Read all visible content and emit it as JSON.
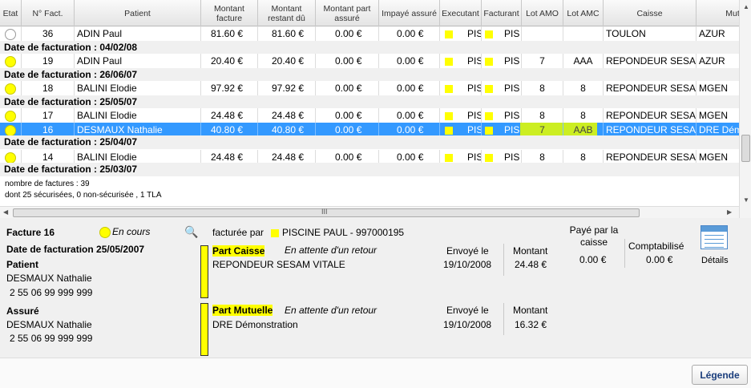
{
  "columns": [
    "Etat",
    "N° Fact.",
    "Patient",
    "Montant facture",
    "Montant restant dû",
    "Montant part assuré",
    "Impayé assuré",
    "Executant",
    "Facturant",
    "Lot AMO",
    "Lot AMC",
    "Caisse",
    "Mut"
  ],
  "rows": [
    {
      "kind": "data",
      "state": "empty",
      "num": "36",
      "patient": "ADIN Paul",
      "montant": "81.60 €",
      "restant": "81.60 €",
      "part": "0.00 €",
      "impaye": "0.00 €",
      "exec": "PIS",
      "fact": "PIS",
      "amo": "",
      "amc": "",
      "caisse": "TOULON",
      "mut": "AZUR"
    },
    {
      "kind": "group",
      "label": "Date de facturation : 04/02/08"
    },
    {
      "kind": "data",
      "state": "yel",
      "num": "19",
      "patient": "ADIN Paul",
      "montant": "20.40 €",
      "restant": "20.40 €",
      "part": "0.00 €",
      "impaye": "0.00 €",
      "exec": "PIS",
      "fact": "PIS",
      "amo": "7",
      "amc": "AAA",
      "caisse": "REPONDEUR SESA",
      "mut": "AZUR"
    },
    {
      "kind": "group",
      "label": "Date de facturation : 26/06/07"
    },
    {
      "kind": "data",
      "state": "yel",
      "num": "18",
      "patient": "BALINI Elodie",
      "montant": "97.92 €",
      "restant": "97.92 €",
      "part": "0.00 €",
      "impaye": "0.00 €",
      "exec": "PIS",
      "fact": "PIS",
      "amo": "8",
      "amc": "8",
      "caisse": "REPONDEUR SESA",
      "mut": "MGEN"
    },
    {
      "kind": "group",
      "label": "Date de facturation : 25/05/07"
    },
    {
      "kind": "data",
      "state": "yel",
      "num": "17",
      "patient": "BALINI Elodie",
      "montant": "24.48 €",
      "restant": "24.48 €",
      "part": "0.00 €",
      "impaye": "0.00 €",
      "exec": "PIS",
      "fact": "PIS",
      "amo": "8",
      "amc": "8",
      "caisse": "REPONDEUR SESA",
      "mut": "MGEN"
    },
    {
      "kind": "sel",
      "state": "yel",
      "num": "16",
      "patient": "DESMAUX Nathalie",
      "montant": "40.80 €",
      "restant": "40.80 €",
      "part": "0.00 €",
      "impaye": "0.00 €",
      "exec": "PIS",
      "fact": "PIS",
      "amo": "7",
      "amc": "AAB",
      "caisse": "REPONDEUR SESA",
      "mut": "DRE Dém"
    },
    {
      "kind": "group",
      "label": "Date de facturation : 25/04/07"
    },
    {
      "kind": "data",
      "state": "yel",
      "num": "14",
      "patient": "BALINI Elodie",
      "montant": "24.48 €",
      "restant": "24.48 €",
      "part": "0.00 €",
      "impaye": "0.00 €",
      "exec": "PIS",
      "fact": "PIS",
      "amo": "8",
      "amc": "8",
      "caisse": "REPONDEUR SESA",
      "mut": "MGEN"
    },
    {
      "kind": "group",
      "label": "Date de facturation : 25/03/07"
    }
  ],
  "summary": {
    "count": "nombre de factures : 39",
    "detail": "dont 25 sécurisées, 0 non-sécurisée , 1 TLA"
  },
  "scroll": {
    "h_label": "III"
  },
  "invoice": {
    "title": "Facture 16",
    "status": "En cours",
    "billed_by_label": "facturée par",
    "billed_by": "PISCINE PAUL - 997000195",
    "date": "Date de facturation 25/05/2007",
    "patient_label": "Patient",
    "patient_name": "DESMAUX Nathalie",
    "patient_nir": "2 55 06 99 999 999",
    "assure_label": "Assuré",
    "assure_name": "DESMAUX Nathalie",
    "assure_nir": "2 55 06 99 999 999",
    "paid_label": "Payé par la caisse",
    "paid_value": "0.00 €",
    "compta_label": "Comptabilisé",
    "compta_value": "0.00 €",
    "details_label": "Détails"
  },
  "part_caisse": {
    "title": "Part Caisse",
    "status": "En attente d'un retour",
    "org": "REPONDEUR SESAM VITALE",
    "sent_label": "Envoyé le",
    "sent_date": "19/10/2008",
    "amount_label": "Montant",
    "amount": "24.48 €"
  },
  "part_mutuelle": {
    "title": "Part Mutuelle",
    "status": "En attente d'un retour",
    "org": "DRE Démonstration",
    "sent_label": "Envoyé le",
    "sent_date": "19/10/2008",
    "amount_label": "Montant",
    "amount": "16.32 €"
  },
  "legend_button": "Légende",
  "colors": {
    "selection": "#3399ff",
    "status_yellow": "#ffff00",
    "highlight": "#ccee22"
  }
}
